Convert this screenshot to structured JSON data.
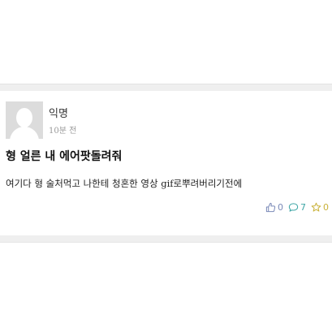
{
  "post": {
    "author": "익명",
    "time": "10분 전",
    "title": "형 얼른 내 에어팟돌려줘",
    "body": "여기다 형 술처먹고 나한테 청혼한 영상 gif로뿌려버리기전에",
    "stats": {
      "likes": "0",
      "comments": "7",
      "stars": "0"
    }
  },
  "icons": {
    "like": "thumbs-up-icon",
    "comment": "speech-bubble-icon",
    "star": "star-icon"
  },
  "colors": {
    "like": "#7b8ab8",
    "comment": "#3fa6a6",
    "star": "#c9b23a",
    "separator": "#efefef"
  }
}
